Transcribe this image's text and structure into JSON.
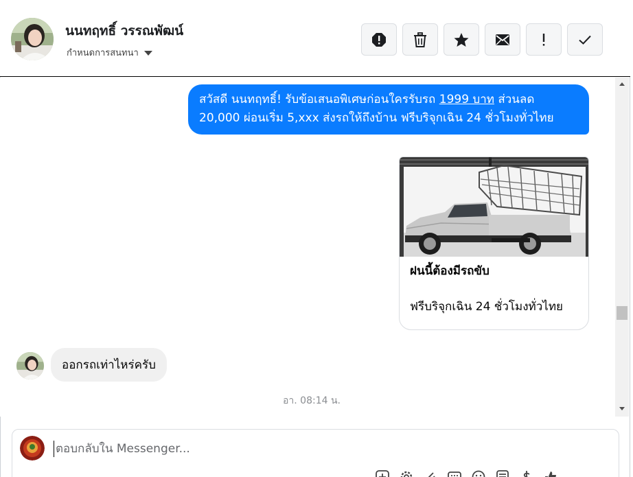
{
  "header": {
    "contact_name": "นนทฤทธิ์ วรรณพัฒน์",
    "assign_label": "กำหนดการสนทนา",
    "actions": [
      {
        "icon": "alert-circle-icon",
        "name": "mark-spam-button"
      },
      {
        "icon": "trash-icon",
        "name": "delete-button"
      },
      {
        "icon": "star-icon",
        "name": "star-button"
      },
      {
        "icon": "envelope-icon",
        "name": "mark-unread-button"
      },
      {
        "icon": "exclamation-icon",
        "name": "follow-up-button"
      },
      {
        "icon": "check-icon",
        "name": "mark-done-button"
      }
    ]
  },
  "messages": {
    "outgoing_text_1": "สวัสดี นนทฤทธิ์! รับข้อเสนอพิเศษก่อนใครรับรถ ",
    "outgoing_link": "1999 บาท",
    "outgoing_text_2": " ส่วนลด 20,000  ผ่อนเริ่ม 5,xxx ส่งรถให้ถึงบ้าน ฟรีบริจุกเฉิน 24 ชั่วโมงทั่วไทย",
    "card": {
      "title": "ฝนนี้ต้องมีรถขับ",
      "subtitle": "ฟรีบริจุกเฉิน 24 ชั่วโมงทั่วไทย"
    },
    "incoming_text": "ออกรถเท่าไหร่ครับ",
    "timestamp": "อา. 08:14 น."
  },
  "composer": {
    "placeholder": "ตอบกลับใน Messenger...",
    "tools": [
      "add-icon",
      "settings-icon",
      "attach-icon",
      "saved-reply-icon",
      "emoji-icon",
      "note-icon",
      "dollar-icon",
      "like-icon"
    ]
  },
  "colors": {
    "outgoing_bubble": "#0a7cff",
    "incoming_bubble": "#f0f0f0",
    "timestamp": "#8a8d91"
  }
}
